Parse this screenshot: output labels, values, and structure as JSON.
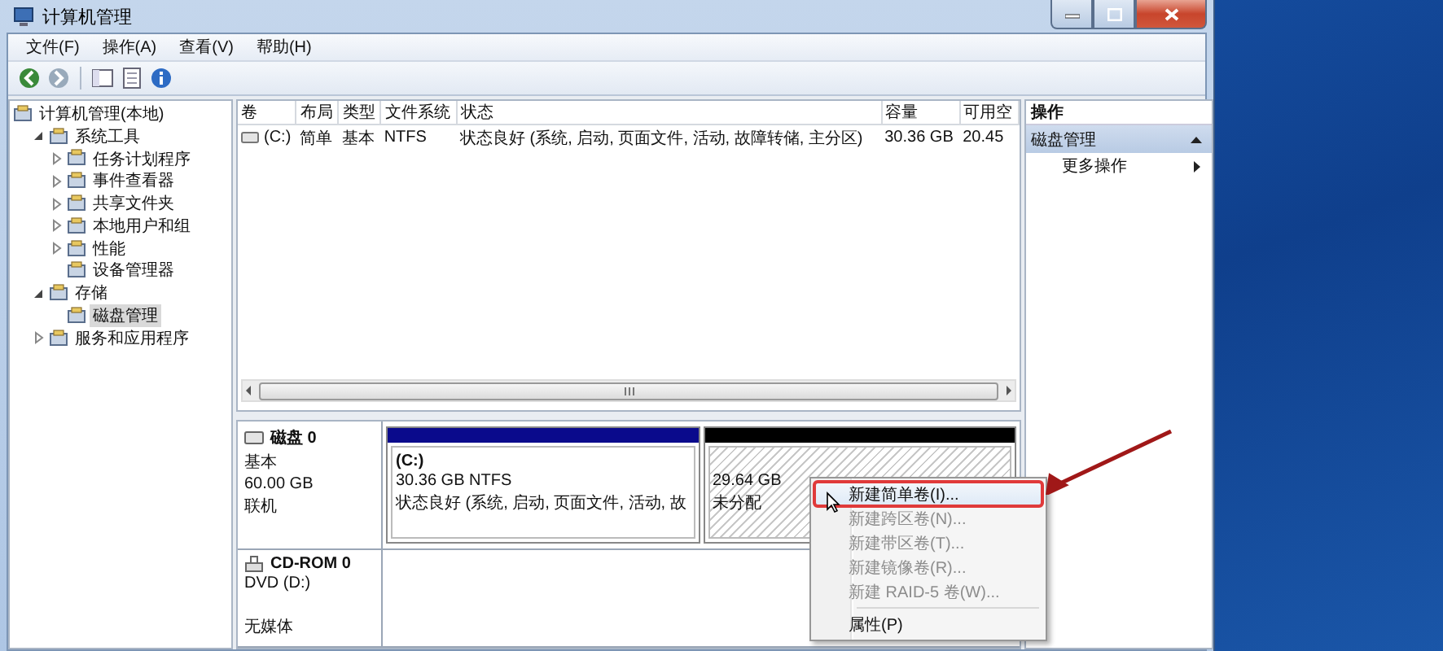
{
  "window": {
    "title": "计算机管理"
  },
  "menu": [
    {
      "label": "文件(F)"
    },
    {
      "label": "操作(A)"
    },
    {
      "label": "查看(V)"
    },
    {
      "label": "帮助(H)"
    }
  ],
  "tree": {
    "label": "计算机管理(本地)",
    "selected": false,
    "children": [
      {
        "label": "系统工具",
        "selected": false,
        "expanded": true,
        "children": [
          {
            "label": "任务计划程序",
            "selected": false,
            "expanded": false
          },
          {
            "label": "事件查看器",
            "selected": false,
            "expanded": false
          },
          {
            "label": "共享文件夹",
            "selected": false,
            "expanded": false
          },
          {
            "label": "本地用户和组",
            "selected": false,
            "expanded": false
          },
          {
            "label": "性能",
            "selected": false,
            "expanded": false
          },
          {
            "label": "设备管理器",
            "selected": false
          }
        ]
      },
      {
        "label": "存储",
        "selected": false,
        "expanded": true,
        "children": [
          {
            "label": "磁盘管理",
            "selected": true
          }
        ]
      },
      {
        "label": "服务和应用程序",
        "selected": false,
        "expanded": false
      }
    ]
  },
  "volumes": {
    "columns": [
      "卷",
      "布局",
      "类型",
      "文件系统",
      "状态",
      "容量",
      "可用空"
    ],
    "rows": [
      {
        "cells": [
          "(C:)",
          "简单",
          "基本",
          "NTFS",
          "状态良好 (系统, 启动, 页面文件, 活动, 故障转储, 主分区)",
          "30.36 GB",
          "20.45"
        ]
      }
    ]
  },
  "disks": [
    {
      "kind": "disk",
      "name": "磁盘 0",
      "type": "基本",
      "size": "60.00 GB",
      "status": "联机",
      "partitions": [
        {
          "kind": "primary",
          "label": "(C:)",
          "lines": [
            "30.36 GB NTFS",
            "状态良好 (系统, 启动, 页面文件, 活动, 故"
          ]
        },
        {
          "kind": "unallocated",
          "lines": [
            "29.64 GB",
            "未分配"
          ]
        }
      ]
    },
    {
      "kind": "cdrom",
      "name": "CD-ROM 0",
      "type": "DVD (D:)",
      "status": "无媒体"
    }
  ],
  "actions": {
    "header": "操作",
    "items": [
      {
        "kind": "section",
        "label": "磁盘管理",
        "expanded": true
      },
      {
        "kind": "link",
        "label": "更多操作"
      }
    ]
  },
  "context_menu": {
    "groups": [
      [
        {
          "label": "新建简单卷(I)...",
          "disabled": false,
          "highlighted": true,
          "annotated": true
        },
        {
          "label": "新建跨区卷(N)...",
          "disabled": true,
          "highlighted": false,
          "annotated": false
        },
        {
          "label": "新建带区卷(T)...",
          "disabled": true,
          "highlighted": false,
          "annotated": false
        },
        {
          "label": "新建镜像卷(R)...",
          "disabled": true,
          "highlighted": false,
          "annotated": false
        },
        {
          "label": "新建 RAID-5 卷(W)...",
          "disabled": true,
          "highlighted": false,
          "annotated": false
        }
      ],
      [
        {
          "label": "属性(P)",
          "disabled": false,
          "highlighted": false,
          "annotated": false
        }
      ]
    ]
  }
}
